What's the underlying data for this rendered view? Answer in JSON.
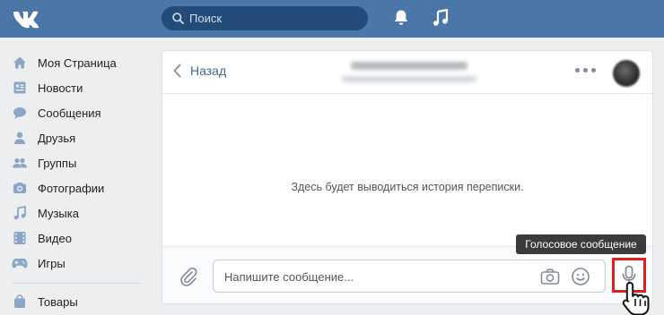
{
  "header": {
    "search_placeholder": "Поиск",
    "icons": [
      "vk-logo-icon",
      "search-icon",
      "bell-icon",
      "music-icon"
    ]
  },
  "sidebar": {
    "items": [
      {
        "label": "Моя Страница",
        "icon": "home-icon"
      },
      {
        "label": "Новости",
        "icon": "news-icon"
      },
      {
        "label": "Сообщения",
        "icon": "messages-icon"
      },
      {
        "label": "Друзья",
        "icon": "friend-icon"
      },
      {
        "label": "Группы",
        "icon": "groups-icon"
      },
      {
        "label": "Фотографии",
        "icon": "camera-icon"
      },
      {
        "label": "Музыка",
        "icon": "music-icon"
      },
      {
        "label": "Видео",
        "icon": "video-icon"
      },
      {
        "label": "Игры",
        "icon": "gamepad-icon"
      },
      {
        "label": "Товары",
        "icon": "bag-icon"
      }
    ]
  },
  "chat": {
    "back_label": "Назад",
    "empty_text": "Здесь будет выводиться история переписки.",
    "input_placeholder": "Напишите сообщение...",
    "tooltip": "Голосовое сообщение"
  },
  "colors": {
    "header_bg": "#4a76a8",
    "link": "#45678f",
    "highlight": "#e01f1f"
  }
}
